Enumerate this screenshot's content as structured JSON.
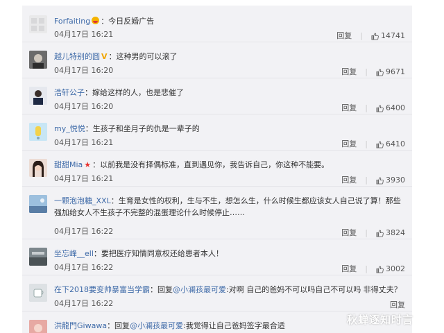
{
  "comments": [
    {
      "user": "Forfaiting",
      "text": "：今日反婚广告",
      "time": "04月17日 16:21",
      "reply": "回复",
      "likes": "14741"
    },
    {
      "user": "越儿特别的圆",
      "text": "：这种男的可以滚了",
      "time": "04月17日 16:20",
      "reply": "回复",
      "likes": "9671"
    },
    {
      "user": "浩轩公子",
      "text": "：嫁给这样的人，也是悲催了",
      "time": "04月17日 16:20",
      "reply": "回复",
      "likes": "6400"
    },
    {
      "user": "my_悦悦",
      "text": "：生孩子和坐月子的仇是一辈子的",
      "time": "04月17日 16:21",
      "reply": "回复",
      "likes": "6410"
    },
    {
      "user": "甜甜Mia",
      "text": "：以前我是没有择偶标准，直到遇见你，我告诉自己，你这种不能要。",
      "time": "04月17日 16:21",
      "reply": "回复",
      "likes": "3930"
    },
    {
      "user": "一颗泡泡糖_XXL",
      "text": "：生育是女性的权利，生与不生，想怎么生，什么时候生都应该女人自己说了算！那些强加给女人不生孩子不完整的混蛋理论什么时候停止……",
      "time": "04月17日 16:22",
      "reply": "回复",
      "likes": "3824"
    },
    {
      "user": "坐忘峰__ell",
      "text": "：要把医疗知情同意权还给患者本人！",
      "time": "04月17日 16:22",
      "reply": "回复",
      "likes": "3002"
    },
    {
      "user": "在下2018要变帅暴富当学霸",
      "text_prefix": "：回复",
      "mention": "@小澜孩最可爱",
      "text": ":对啊 自己的爸妈不可以吗自己不可以吗 非得丈夫？",
      "time": "04月17日 16:22",
      "reply": "回复"
    },
    {
      "user": "洪龍門Giwawa",
      "text_prefix": "：回复",
      "mention": "@小澜孩最可爱",
      "text": ":我觉得让自己爸妈签字最合适"
    }
  ],
  "watermark": "秋蝉逐知时言",
  "colors": {
    "username": "#3e6aa8",
    "panel": "#f2f2f5"
  }
}
